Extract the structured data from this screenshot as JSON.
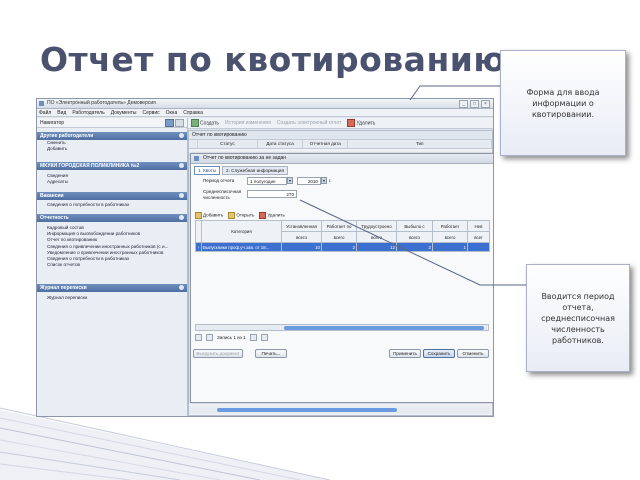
{
  "slide": {
    "title": "Отчет по квотированию."
  },
  "window": {
    "title": "ПО «Электронный работодатель» Демоверсия",
    "menu": [
      "Файл",
      "Вид",
      "Работодатель",
      "Документы",
      "Сервис",
      "Окна",
      "Справка"
    ]
  },
  "nav": {
    "header": "Навигатор",
    "sections": [
      {
        "title": "Другие работодатели",
        "items": [
          "Сменить",
          "Добавить"
        ]
      },
      {
        "title": "МКУКИ ГОРОДСКАЯ ПОЛИКЛИНИКА №2",
        "items": [
          "Сведения",
          "Адресаты"
        ]
      },
      {
        "title": "Вакансии",
        "items": [
          "Сведения о потребности в работниках"
        ]
      },
      {
        "title": "Отчетность",
        "items": [
          "Кадровый состав",
          "Информация о высвобождении работников",
          "Отчет по квотированию",
          "Сведения о привлечении иностранных работников (с и...",
          "Уведомление о привлечении иностранных работников",
          "Сведения о потребности в работниках",
          "Список отчетов"
        ]
      },
      {
        "title": "Журнал переписки",
        "items": [
          "Журнал переписки"
        ]
      }
    ]
  },
  "toolbar": {
    "save": "Создать",
    "history": "История изменения",
    "send": "Создать электронный отчет",
    "delete": "Удалить"
  },
  "panel": {
    "title": "Отчет по квотированию",
    "columns": [
      "Статус",
      "Дата статуса",
      "Отчетная дата",
      "Тип"
    ]
  },
  "dialog": {
    "title": "Отчет по квотированию за не задан",
    "tabs": [
      "1. Квоты",
      "2. Служебная информация"
    ],
    "period_label": "Период отчета",
    "period_value": "1 полугодие",
    "year_value": "2010",
    "year_suffix": "г.",
    "headcount_label_1": "Среднесписочная",
    "headcount_label_2": "численность",
    "headcount_value": "270",
    "tools": {
      "add": "Добавить",
      "open": "Открыть",
      "delete": "Удалить"
    },
    "table": {
      "category_header": "Категория",
      "col_headers": [
        "Установленная",
        "Работает по",
        "Трудоустроено",
        "Выбыло с",
        "Работает",
        "Нев"
      ],
      "sub_headers": [
        "всего",
        "всего",
        "всего",
        "всего",
        "всего",
        "всег"
      ],
      "row": {
        "name": "Выпускники проф.уч.зав. от 18...",
        "values": [
          "10",
          "2",
          "12",
          "2",
          "1",
          ""
        ]
      }
    },
    "pager": {
      "text": "Запись 1 из 1"
    },
    "buttons": {
      "upload": "Выгрузить документ",
      "print": "Печать...",
      "apply": "Применить",
      "save": "Сохранить",
      "cancel": "Отменить"
    }
  },
  "callouts": {
    "top": "Форма для ввода\nинформации о\nквотировании.",
    "bottom": "Вводится период\nотчета,\nсреднесписочная\nчисленность\nработников."
  }
}
